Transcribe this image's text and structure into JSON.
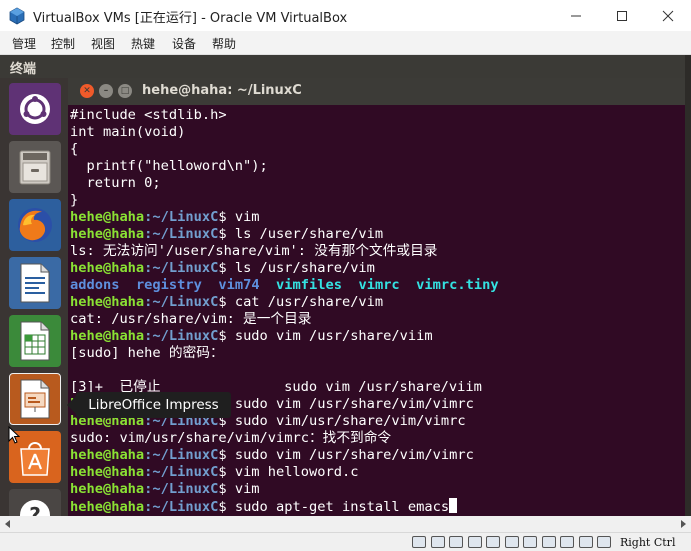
{
  "window": {
    "title": "VirtualBox VMs [正在运行] - Oracle VM VirtualBox",
    "controls": {
      "minimize": "minimize-icon",
      "maximize": "maximize-icon",
      "close": "close-icon"
    }
  },
  "menubar": {
    "items": [
      "管理",
      "控制",
      "视图",
      "热键",
      "设备",
      "帮助"
    ]
  },
  "panel": {
    "title": "终端"
  },
  "launcher": {
    "items": [
      {
        "name": "dash-home",
        "icon": "ubuntu-logo-icon"
      },
      {
        "name": "files",
        "icon": "file-cabinet-icon"
      },
      {
        "name": "firefox",
        "icon": "firefox-icon"
      },
      {
        "name": "libreoffice-writer",
        "icon": "writer-document-icon"
      },
      {
        "name": "libreoffice-calc",
        "icon": "calc-spreadsheet-icon"
      },
      {
        "name": "libreoffice-impress",
        "icon": "impress-presentation-icon"
      },
      {
        "name": "software-center",
        "icon": "shopping-bag-icon"
      },
      {
        "name": "help",
        "icon": "help-icon"
      }
    ],
    "tooltip": "LibreOffice Impress"
  },
  "terminal": {
    "title": "hehe@haha: ~/LinuxC",
    "prompt_user": "hehe@haha",
    "prompt_path": ":~/LinuxC",
    "prompt_sign": "$ ",
    "lines": [
      {
        "kind": "out",
        "text": "#include <stdlib.h>"
      },
      {
        "kind": "out",
        "text": "int main(void)"
      },
      {
        "kind": "out",
        "text": "{"
      },
      {
        "kind": "out",
        "text": "  printf(\"helloword\\n\");"
      },
      {
        "kind": "out",
        "text": "  return 0;"
      },
      {
        "kind": "out",
        "text": "}"
      },
      {
        "kind": "cmd",
        "text": "vim"
      },
      {
        "kind": "cmd",
        "text": "ls /user/share/vim"
      },
      {
        "kind": "out",
        "text": "ls: 无法访问'/user/share/vim': 没有那个文件或目录"
      },
      {
        "kind": "cmd",
        "text": "ls /usr/share/vim"
      },
      {
        "kind": "ls",
        "entries": [
          {
            "text": "addons",
            "type": "dir"
          },
          {
            "text": "  ",
            "type": "sep"
          },
          {
            "text": "registry",
            "type": "dir"
          },
          {
            "text": "  ",
            "type": "sep"
          },
          {
            "text": "vim74",
            "type": "dir"
          },
          {
            "text": "  ",
            "type": "sep"
          },
          {
            "text": "vimfiles",
            "type": "link"
          },
          {
            "text": "  ",
            "type": "sep"
          },
          {
            "text": "vimrc",
            "type": "link"
          },
          {
            "text": "  ",
            "type": "sep"
          },
          {
            "text": "vimrc.tiny",
            "type": "link"
          }
        ]
      },
      {
        "kind": "cmd",
        "text": "cat /usr/share/vim"
      },
      {
        "kind": "out",
        "text": "cat: /usr/share/vim: 是一个目录"
      },
      {
        "kind": "cmd",
        "text": "sudo vim /usr/share/viim"
      },
      {
        "kind": "out",
        "text": "[sudo] hehe 的密码："
      },
      {
        "kind": "out",
        "text": ""
      },
      {
        "kind": "out",
        "text": "[3]+  已停止               sudo vim /usr/share/viim"
      },
      {
        "kind": "cmd",
        "text": "sudo vim /usr/share/vim/vimrc"
      },
      {
        "kind": "cmd",
        "text": "sudo vim/usr/share/vim/vimrc"
      },
      {
        "kind": "out",
        "text": "sudo: vim/usr/share/vim/vimrc：找不到命令"
      },
      {
        "kind": "cmd",
        "text": "sudo vim /usr/share/vim/vimrc"
      },
      {
        "kind": "cmd",
        "text": "vim helloword.c"
      },
      {
        "kind": "cmd",
        "text": "vim"
      },
      {
        "kind": "cmd",
        "text": "sudo apt-get install emacs",
        "cursor": true
      }
    ]
  },
  "statusbar": {
    "icons": [
      "hdd-icon",
      "optical-disc-icon",
      "usb-icon",
      "shared-folder-icon",
      "pencil-icon",
      "display-icon",
      "network-icon",
      "recording-icon",
      "cpu-icon",
      "mouse-integration-icon",
      "keyboard-capture-icon"
    ],
    "host_key": "Right Ctrl"
  },
  "colors": {
    "terminal_bg": "#300a24",
    "prompt_user": "#8ae234",
    "prompt_path": "#729fcf",
    "ls_dir": "#5e8fdd",
    "ls_link": "#34e2e2",
    "term_close": "#f05a2a"
  }
}
